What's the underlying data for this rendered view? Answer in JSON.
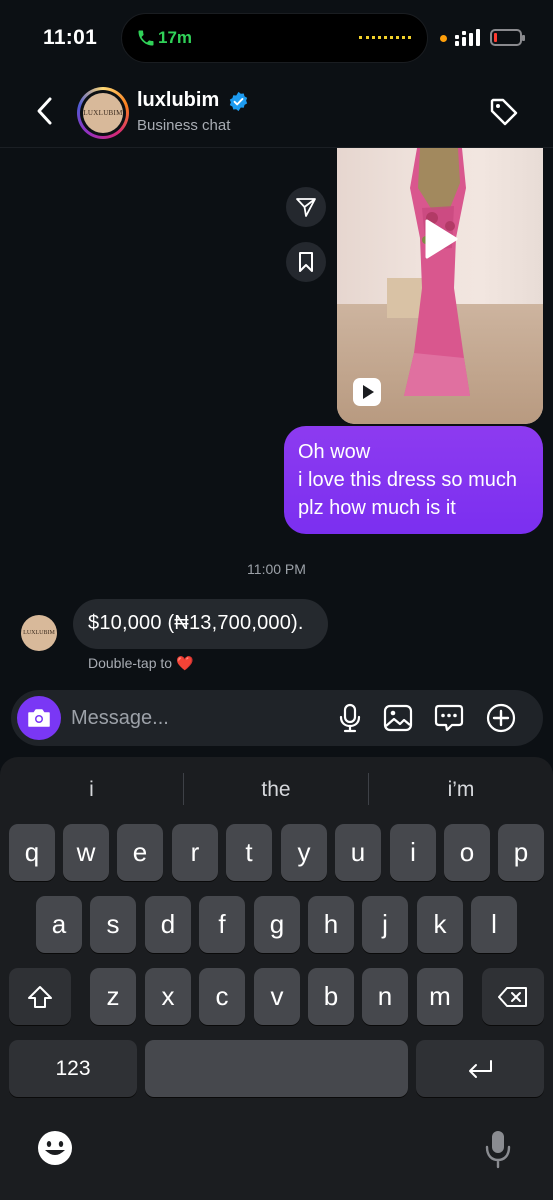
{
  "status_bar": {
    "time": "11:01",
    "call_duration": "17m",
    "call_icon": "phone-icon",
    "signal_icon": "signal-icon",
    "battery_icon": "battery-low-icon",
    "battery_color": "#ff3b30",
    "call_color": "#30d158"
  },
  "header": {
    "back_icon": "chevron-left-icon",
    "avatar_text": "LUXLUBIM",
    "username": "luxlubim",
    "verified_icon": "verified-badge-icon",
    "subtitle": "Business chat",
    "tag_icon": "tag-icon"
  },
  "messages": {
    "video": {
      "play_icon": "play-icon",
      "reel_icon": "reels-icon"
    },
    "share_icon": "share-icon",
    "save_icon": "bookmark-icon",
    "outgoing": {
      "lines": [
        "Oh wow",
        "i love this dress so much",
        "plz how much is it"
      ],
      "color": "#7b2ff0"
    },
    "timestamp": "11:00 PM",
    "incoming": {
      "text": "$10,000  (₦13,700,000).",
      "avatar_text": "LUXLUBIM"
    },
    "double_tap_hint": "Double-tap to ❤️"
  },
  "composer": {
    "camera_icon": "camera-icon",
    "placeholder": "Message...",
    "mic_icon": "microphone-icon",
    "gallery_icon": "image-icon",
    "sticker_icon": "chat-bubble-icon",
    "add_icon": "plus-circle-icon",
    "accent": "#7a37f5"
  },
  "keyboard": {
    "suggestions": [
      "i",
      "the",
      "i’m"
    ],
    "row1": [
      "q",
      "w",
      "e",
      "r",
      "t",
      "y",
      "u",
      "i",
      "o",
      "p"
    ],
    "row2": [
      "a",
      "s",
      "d",
      "f",
      "g",
      "h",
      "j",
      "k",
      "l"
    ],
    "row3": [
      "z",
      "x",
      "c",
      "v",
      "b",
      "n",
      "m"
    ],
    "numbers_key": "123",
    "shift_icon": "shift-icon",
    "delete_icon": "backspace-icon",
    "return_icon": "return-icon",
    "emoji_icon": "emoji-icon",
    "dictation_icon": "microphone-icon"
  }
}
